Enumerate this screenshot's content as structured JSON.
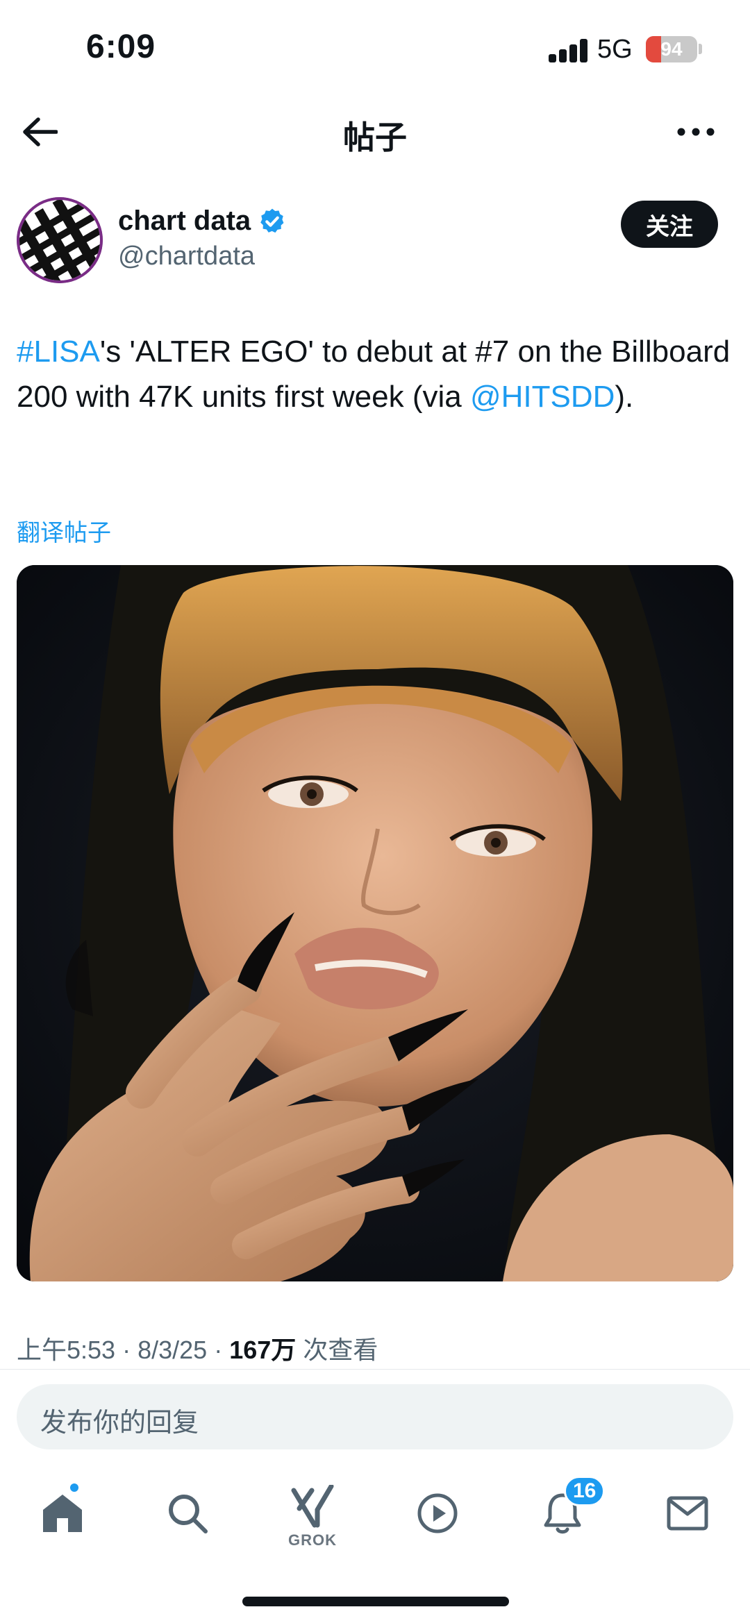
{
  "status_bar": {
    "time": "6:09",
    "network": "5G",
    "battery": "94",
    "battery_level": 0.3
  },
  "header": {
    "title": "帖子",
    "back_icon": "arrow-left-icon",
    "more_icon": "more-horizontal-icon"
  },
  "author": {
    "name": "chart data",
    "handle": "@chartdata",
    "verified": true,
    "follow_label": "关注"
  },
  "post": {
    "hashtag": "#LISA",
    "text_part1": "'s 'ALTER EGO' to debut at #7 on the Billboard 200 with 47K units first week (via ",
    "mention": "@HITSDD",
    "text_part2": ").",
    "translate_label": "翻译帖子"
  },
  "meta": {
    "time": "上午5:53",
    "date": "8/3/25",
    "views": "167万",
    "views_label": "次查看",
    "separator": "·"
  },
  "reply": {
    "placeholder": "发布你的回复"
  },
  "tab_bar": {
    "grok_label": "GROK",
    "notifications_count": "16"
  },
  "colors": {
    "accent": "#1d9bf0",
    "text": "#0f1419",
    "secondary": "#536471"
  }
}
